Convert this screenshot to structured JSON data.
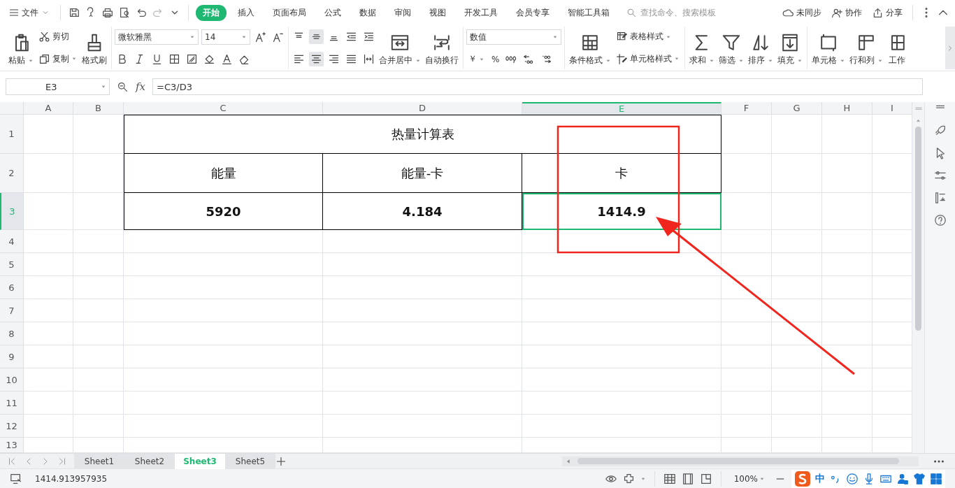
{
  "menu_bar": {
    "file_menu": "文件",
    "tabs": [
      {
        "label": "开始",
        "selected": true
      },
      {
        "label": "插入",
        "selected": false
      },
      {
        "label": "页面布局",
        "selected": false
      },
      {
        "label": "公式",
        "selected": false
      },
      {
        "label": "数据",
        "selected": false
      },
      {
        "label": "审阅",
        "selected": false
      },
      {
        "label": "视图",
        "selected": false
      },
      {
        "label": "开发工具",
        "selected": false
      },
      {
        "label": "会员专享",
        "selected": false
      },
      {
        "label": "智能工具箱",
        "selected": false
      }
    ],
    "search": {
      "placeholder": "查找命令、搜索模板"
    },
    "actions": [
      "未同步",
      "协作",
      "分享"
    ]
  },
  "ribbon": {
    "clipboard": {
      "paste": "粘贴",
      "cut": "剪切",
      "copy": "复制",
      "format_painter": "格式刷"
    },
    "font": {
      "name": "微软雅黑",
      "size": "14"
    },
    "alignment": {
      "merge": "合并居中",
      "wrap": "自动换行",
      "middle_selected": true,
      "center_selected": true
    },
    "number": {
      "format": "数值",
      "currency": "￥",
      "percent": "%"
    },
    "styles": {
      "conditional": "条件格式",
      "table_style": "表格样式",
      "cell_style": "单元格样式"
    },
    "editing": [
      "求和",
      "筛选",
      "排序",
      "填充"
    ],
    "cells": [
      "单元格",
      "行和列",
      "工作"
    ]
  },
  "formula_bar": {
    "name_box": "E3",
    "function_label": "fx",
    "formula": "=C3/D3"
  },
  "sheet": {
    "columns": [
      {
        "label": "A",
        "selected": false
      },
      {
        "label": "B",
        "selected": false
      },
      {
        "label": "C",
        "selected": false
      },
      {
        "label": "D",
        "selected": false
      },
      {
        "label": "E",
        "selected": true
      },
      {
        "label": "F",
        "selected": false
      },
      {
        "label": "G",
        "selected": false
      },
      {
        "label": "H",
        "selected": false
      },
      {
        "label": "I",
        "selected": false
      }
    ],
    "rows": [
      {
        "label": "1",
        "selected": false
      },
      {
        "label": "2",
        "selected": false
      },
      {
        "label": "3",
        "selected": true
      },
      {
        "label": "4",
        "selected": false
      },
      {
        "label": "5",
        "selected": false
      },
      {
        "label": "6",
        "selected": false
      },
      {
        "label": "7",
        "selected": false
      },
      {
        "label": "8",
        "selected": false
      },
      {
        "label": "9",
        "selected": false
      },
      {
        "label": "10",
        "selected": false
      },
      {
        "label": "11",
        "selected": false
      },
      {
        "label": "12",
        "selected": false
      },
      {
        "label": "13",
        "selected": false
      }
    ],
    "table": {
      "title": "热量计算表",
      "headers": [
        "能量",
        "能量-卡",
        "卡"
      ],
      "values": [
        {
          "text": "5920",
          "selected": false
        },
        {
          "text": "4.184",
          "selected": false
        },
        {
          "text": "1414.9",
          "selected": true
        }
      ]
    }
  },
  "sheet_tabs": [
    {
      "label": "Sheet1",
      "selected": false
    },
    {
      "label": "Sheet2",
      "selected": false
    },
    {
      "label": "Sheet3",
      "selected": true
    },
    {
      "label": "Sheet5",
      "selected": false
    }
  ],
  "status_bar": {
    "value": "1414.913957935",
    "zoom": "100%",
    "ime_mode": "中"
  },
  "annotations": {
    "highlight_frame": true,
    "arrow": true
  }
}
